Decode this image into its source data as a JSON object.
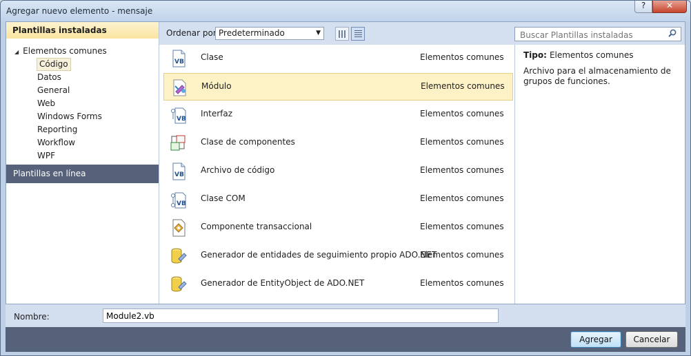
{
  "window": {
    "title": "Agregar nuevo elemento - mensaje",
    "help_label": "?",
    "close_label": "✕"
  },
  "left": {
    "header": "Plantillas instaladas",
    "parent": "Elementos comunes",
    "items": [
      "Código",
      "Datos",
      "General",
      "Web",
      "Windows Forms",
      "Reporting",
      "Workflow",
      "WPF"
    ],
    "selected_index": 0,
    "online": "Plantillas en línea"
  },
  "toolbar": {
    "sort_label": "Ordenar por:",
    "sort_value": "Predeterminado",
    "search_placeholder": "Buscar Plantillas instaladas"
  },
  "templates": [
    {
      "name": "Clase",
      "category": "Elementos comunes",
      "icon": "vb-class-icon"
    },
    {
      "name": "Módulo",
      "category": "Elementos comunes",
      "icon": "module-icon"
    },
    {
      "name": "Interfaz",
      "category": "Elementos comunes",
      "icon": "vb-interface-icon"
    },
    {
      "name": "Clase de componentes",
      "category": "Elementos comunes",
      "icon": "component-class-icon"
    },
    {
      "name": "Archivo de código",
      "category": "Elementos comunes",
      "icon": "code-file-icon"
    },
    {
      "name": "Clase COM",
      "category": "Elementos comunes",
      "icon": "com-class-icon"
    },
    {
      "name": "Componente transaccional",
      "category": "Elementos comunes",
      "icon": "transactional-component-icon"
    },
    {
      "name": "Generador de entidades de seguimiento propio ADO.NET",
      "category": "Elementos comunes",
      "icon": "database-generator-icon"
    },
    {
      "name": "Generador de EntityObject de ADO.NET",
      "category": "Elementos comunes",
      "icon": "database-generator-icon"
    }
  ],
  "selected_template": 1,
  "details": {
    "type_label": "Tipo:",
    "type_value": "Elementos comunes",
    "description": "Archivo para el almacenamiento de grupos de funciones."
  },
  "name_field": {
    "label": "Nombre:",
    "value": "Module2.vb"
  },
  "buttons": {
    "add": "Agregar",
    "cancel": "Cancelar"
  }
}
